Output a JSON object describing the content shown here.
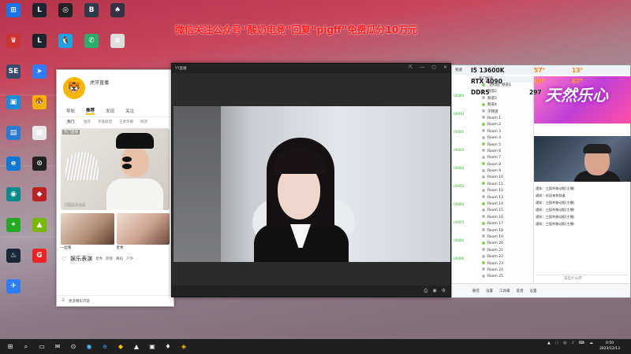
{
  "banner": "微信关注公众号“酸奶电竞”回复“pigff”免费瓜分10万元",
  "desktop_icons": [
    {
      "label": "",
      "glyph": "⊞",
      "color": "#1a73e8"
    },
    {
      "label": "",
      "glyph": "L",
      "color": "#1c2430"
    },
    {
      "label": "",
      "glyph": "◎",
      "color": "#222"
    },
    {
      "label": "",
      "glyph": "B",
      "color": "#2d3b4a"
    },
    {
      "label": "",
      "glyph": "♠",
      "color": "#334"
    },
    {
      "label": "",
      "glyph": "♛",
      "color": "#c33"
    },
    {
      "label": "",
      "glyph": "L",
      "color": "#1c2430"
    },
    {
      "label": "",
      "glyph": "🐧",
      "color": "#1fa0e0"
    },
    {
      "label": "",
      "glyph": "✆",
      "color": "#2aae67"
    },
    {
      "label": "",
      "glyph": "≡",
      "color": "#ddd"
    },
    {
      "label": "",
      "glyph": "SE",
      "color": "#3a4a6a"
    },
    {
      "label": "",
      "glyph": "➤",
      "color": "#2f7df6"
    },
    {
      "label": "",
      "glyph": "▣",
      "color": "#1b8cd8"
    },
    {
      "label": "",
      "glyph": "🐯",
      "color": "#f2b400"
    },
    {
      "label": "",
      "glyph": "▤",
      "color": "#2b7bd3"
    },
    {
      "label": "",
      "glyph": "▦",
      "color": "#e9e9e9"
    },
    {
      "label": "",
      "glyph": "e",
      "color": "#0f7ad5"
    },
    {
      "label": "",
      "glyph": "⊙",
      "color": "#222"
    },
    {
      "label": "",
      "glyph": "◉",
      "color": "#0a8a8a"
    },
    {
      "label": "",
      "glyph": "◆",
      "color": "#b22"
    },
    {
      "label": "",
      "glyph": "✦",
      "color": "#2a2"
    },
    {
      "label": "",
      "glyph": "▲",
      "color": "#76b900"
    },
    {
      "label": "",
      "glyph": "♨",
      "color": "#1b2838"
    },
    {
      "label": "",
      "glyph": "G",
      "color": "#e22"
    },
    {
      "label": "",
      "glyph": "✈",
      "color": "#2f7df6"
    }
  ],
  "liveapp": {
    "name": "虎牙直播",
    "tabs": [
      "导航",
      "推荐",
      "发现",
      "关注"
    ],
    "subtabs": [
      "热门",
      "推荐",
      "英雄联盟",
      "王者荣耀",
      "网游"
    ],
    "feature_label": "热门直播",
    "feature_caption": "三国杀移动版",
    "thumbs": [
      "一起看",
      "星秀"
    ],
    "section": "娱乐表演",
    "section_tabs": [
      "星秀",
      "颜值",
      "舞蹈",
      "户外"
    ],
    "bottom": "更多精彩内容"
  },
  "video": {
    "title": "YY直播"
  },
  "chat": {
    "title": "频道",
    "left_counts": [
      "(0000)",
      "(0001)",
      "(0002)",
      "(0003)",
      "(0004)",
      "(0005)",
      "(0006)",
      "(0007)",
      "(0008)",
      "(0009)"
    ],
    "sections": [
      "热门频道"
    ],
    "rows": [
      "【频道】频道1",
      "频道2",
      "频道3",
      "频道4",
      "子频道",
      "Room 1",
      "Room 2",
      "Room 3",
      "Room 4",
      "Room 5",
      "Room 6",
      "Room 7",
      "Room 8",
      "Room 9",
      "Room 10",
      "Room 11",
      "Room 12",
      "Room 13",
      "Room 14",
      "Room 15",
      "Room 16",
      "Room 17",
      "Room 18",
      "Room 19",
      "Room 20",
      "Room 21",
      "Room 22",
      "Room 23",
      "Room 24",
      "Room 25"
    ],
    "banner_text": "天然乐心",
    "messages": [
      "通知：三国杀移动版(主播)",
      "通知：欢迎来到频道",
      "通知：三国杀移动版(主播)",
      "通知：三国杀移动版(主播)",
      "通知：三国杀移动版(主播)",
      "通知：三国杀移动版(主播)"
    ],
    "input_placeholder": "说些什么吧",
    "bottom_items": [
      "静音",
      "设置",
      "工具箱",
      "反馈",
      "设置"
    ]
  },
  "hardware": {
    "cpu": "I5 13600K",
    "cpu_temp": "57°",
    "cpu_load": "13°",
    "gpu": "RTX 4090",
    "gpu_temp": "30°",
    "gpu_load": "47°",
    "ddr": "DDR5",
    "ddr_val": "297"
  },
  "taskbar": {
    "time": "0:50",
    "date": "2023/12/13"
  }
}
